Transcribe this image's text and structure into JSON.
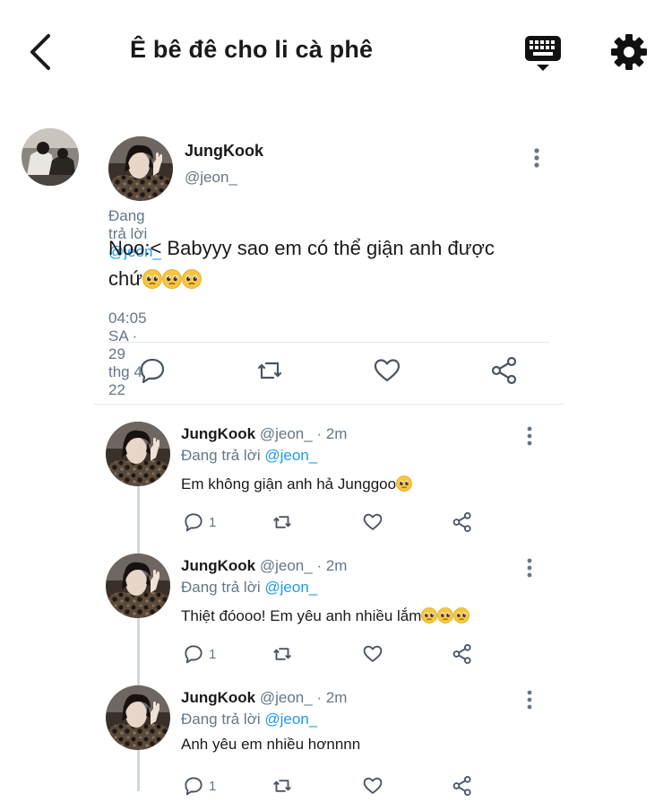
{
  "header": {
    "title": "Ê bê đê cho li cà phê",
    "back_icon": "chevron-left-icon",
    "keyboard_icon": "keyboard-icon",
    "settings_icon": "gear-icon"
  },
  "colors": {
    "mention": "#1d9bf0",
    "secondary_text": "#657786",
    "primary_text": "#1a1a1a",
    "divider": "#e1e8ed",
    "thread_line": "#cfd9de"
  },
  "main_tweet": {
    "name": "JungKook",
    "handle": "@jeon_",
    "replying_label": "Đang trả lời",
    "replying_to": "@jeon_",
    "text_line1": "Noo:< Babyyy sao em có thể giận anh được",
    "text_line2": "chứ",
    "emoji": "pleading-face-emoji",
    "emoji_count": 3,
    "timestamp": "04:05 SA · 29 thg 4 22",
    "actions": [
      "reply-icon",
      "retweet-icon",
      "like-icon",
      "share-icon"
    ]
  },
  "replies": [
    {
      "name": "JungKook",
      "handle": "@jeon_",
      "time": "· 2m",
      "replying_label": "Đang trả lời",
      "replying_to": "@jeon_",
      "text": "Em không giận anh hả Junggoo",
      "emoji_count": 1,
      "reply_count": "1"
    },
    {
      "name": "JungKook",
      "handle": "@jeon_",
      "time": "· 2m",
      "replying_label": "Đang trả lời",
      "replying_to": "@jeon_",
      "text": "Thiệt đóooo! Em yêu anh nhiều lắm",
      "emoji_count": 3,
      "reply_count": "1"
    },
    {
      "name": "JungKook",
      "handle": "@jeon_",
      "time": "· 2m",
      "replying_label": "Đang trả lời",
      "replying_to": "@jeon_",
      "text": "Anh yêu em nhiều hơnnnn",
      "emoji_count": 0,
      "reply_count": "1"
    }
  ]
}
